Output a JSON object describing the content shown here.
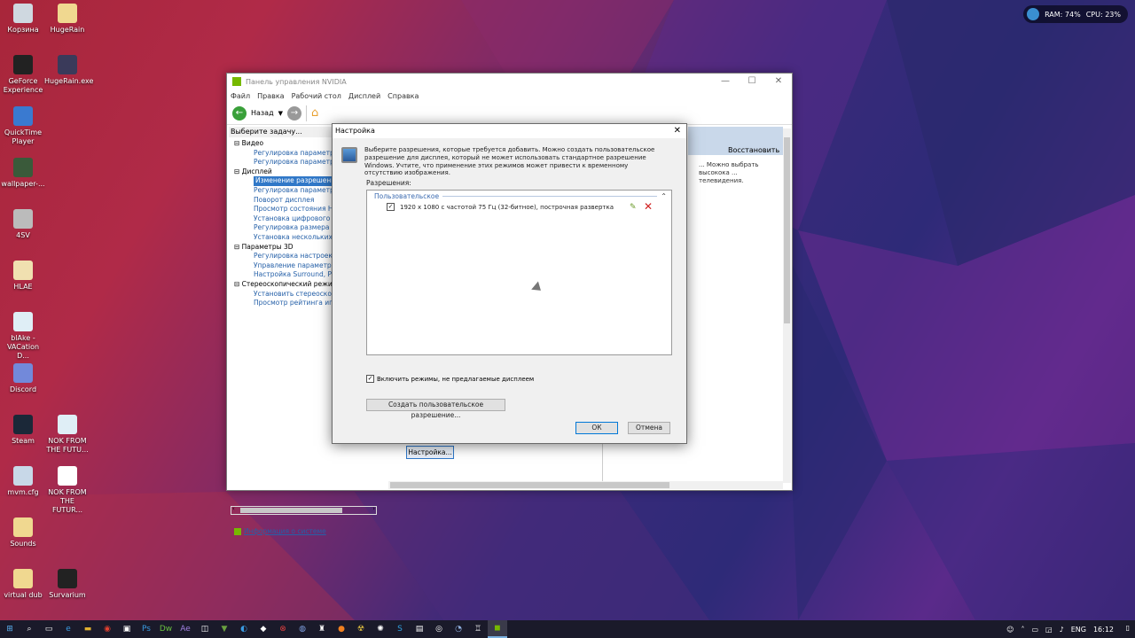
{
  "desktop": {
    "icons": [
      {
        "label": "Корзина",
        "icon": "recycle-bin-icon",
        "color": "#cfd8e0"
      },
      {
        "label": "HugeRain",
        "icon": "folder-icon",
        "color": "#f0d890"
      },
      {
        "label": "GeForce Experience",
        "icon": "geforce-icon",
        "color": "#222222"
      },
      {
        "label": "HugeRain.exe",
        "icon": "app-icon",
        "color": "#3a3a5a"
      },
      {
        "label": "QuickTime Player",
        "icon": "quicktime-icon",
        "color": "#3a7ad0"
      },
      {
        "label": "wallpaper-...",
        "icon": "image-icon",
        "color": "#3a5a3a"
      },
      {
        "label": "4SV",
        "icon": "file-icon",
        "color": "#bbbbbb"
      },
      {
        "label": "HLAE",
        "icon": "file-icon",
        "color": "#f0e0b0"
      },
      {
        "label": "blAke - VACation D...",
        "icon": "media-icon",
        "color": "#dfeef6"
      },
      {
        "label": "Discord",
        "icon": "discord-icon",
        "color": "#7289da"
      },
      {
        "label": "Steam",
        "icon": "steam-icon",
        "color": "#1b2838"
      },
      {
        "label": "NOK FROM THE FUTU...",
        "icon": "media-icon",
        "color": "#dfeef6"
      },
      {
        "label": "mvm.cfg",
        "icon": "file-icon",
        "color": "#c8d8e8"
      },
      {
        "label": "NOK FROM THE FUTUR...",
        "icon": "file-icon",
        "color": "#ffffff"
      },
      {
        "label": "Sounds",
        "icon": "folder-icon",
        "color": "#f0d890"
      },
      {
        "label": "virtual dub",
        "icon": "folder-icon",
        "color": "#f0d890"
      },
      {
        "label": "Survarium",
        "icon": "survarium-icon",
        "color": "#222222"
      }
    ]
  },
  "widget": {
    "ram": "RAM: 74%",
    "cpu": "CPU: 23%"
  },
  "nvidia": {
    "title": "Панель управления NVIDIA",
    "menu": [
      "Файл",
      "Правка",
      "Рабочий стол",
      "Дисплей",
      "Справка"
    ],
    "back_label": "Назад",
    "task_header": "Выберите задачу...",
    "tree": [
      {
        "type": "cat",
        "label": "Видео"
      },
      {
        "type": "item",
        "label": "Регулировка параметров ц"
      },
      {
        "type": "item",
        "label": "Регулировка параметров и"
      },
      {
        "type": "cat",
        "label": "Дисплей"
      },
      {
        "type": "sel",
        "label": "Изменение разрешения"
      },
      {
        "type": "item",
        "label": "Регулировка параметров ц"
      },
      {
        "type": "item",
        "label": "Поворот дисплея"
      },
      {
        "type": "item",
        "label": "Просмотр состояния HDCP"
      },
      {
        "type": "item",
        "label": "Установка цифрового ауд"
      },
      {
        "type": "item",
        "label": "Регулировка размера и по"
      },
      {
        "type": "item",
        "label": "Установка нескольких ди"
      },
      {
        "type": "cat",
        "label": "Параметры 3D"
      },
      {
        "type": "item",
        "label": "Регулировка настроек изо"
      },
      {
        "type": "item",
        "label": "Управление параметрами"
      },
      {
        "type": "item",
        "label": "Настройка Surround, PhysX"
      },
      {
        "type": "cat",
        "label": "Стереоскопический режим 3D"
      },
      {
        "type": "item",
        "label": "Установить стереоскопиче"
      },
      {
        "type": "item",
        "label": "Просмотр рейтинга игр"
      }
    ],
    "sysinfo": "Информация о системе",
    "restore": "Восстановить",
    "right_text": "... Можно выбрать высокока ... телевидения.",
    "settings_button": "Настройка..."
  },
  "dialog": {
    "title": "Настройка",
    "description": "Выберите разрешения, которые требуется добавить. Можно создать пользовательское разрешение для дисплея, который не может использовать стандартное разрешение Windows. Учтите, что применение этих режимов может привести к временному отсутствию изображения.",
    "resolutions_label": "Разрешения:",
    "group": "Пользовательское",
    "entry": "1920 x 1080 с частотой 75 Гц (32-битное), построчная развертка",
    "checkbox_label": "Включить режимы, не предлагаемые дисплеем",
    "create_button": "Создать пользовательское разрешение...",
    "ok": "ОК",
    "cancel": "Отмена"
  },
  "taskbar": {
    "lang": "ENG",
    "time": "16:12"
  }
}
